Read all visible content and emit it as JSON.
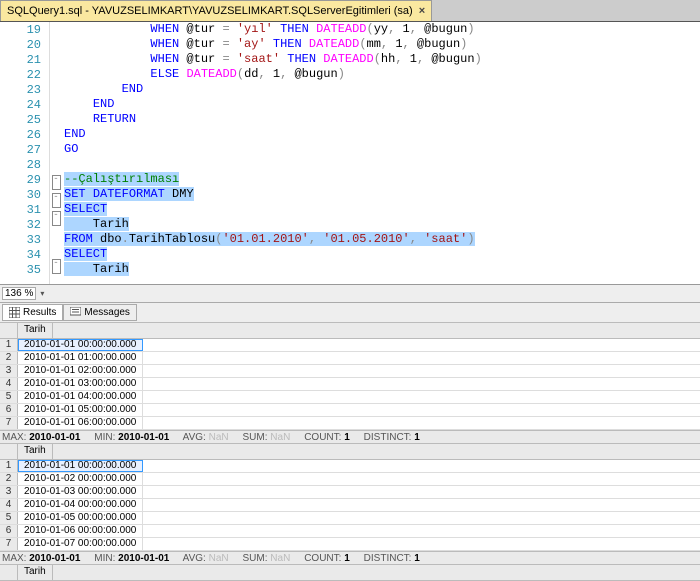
{
  "tab": {
    "title": "SQLQuery1.sql - YAVUZSELIMKART\\YAVUZSELIMKART.SQLServerEgitimleri (sa)",
    "close": "×"
  },
  "editor": {
    "lines": [
      {
        "n": 19,
        "html": "            <span class='kw'>WHEN</span> @tur <span class='op'>=</span> <span class='str'>'yıl'</span> <span class='kw'>THEN</span> <span class='fn'>DATEADD</span><span class='op'>(</span>yy<span class='op'>,</span> <span class='num'>1</span><span class='op'>,</span> @bugun<span class='op'>)</span>"
      },
      {
        "n": 20,
        "html": "            <span class='kw'>WHEN</span> @tur <span class='op'>=</span> <span class='str'>'ay'</span> <span class='kw'>THEN</span> <span class='fn'>DATEADD</span><span class='op'>(</span>mm<span class='op'>,</span> <span class='num'>1</span><span class='op'>,</span> @bugun<span class='op'>)</span>"
      },
      {
        "n": 21,
        "html": "            <span class='kw'>WHEN</span> @tur <span class='op'>=</span> <span class='str'>'saat'</span> <span class='kw'>THEN</span> <span class='fn'>DATEADD</span><span class='op'>(</span>hh<span class='op'>,</span> <span class='num'>1</span><span class='op'>,</span> @bugun<span class='op'>)</span>"
      },
      {
        "n": 22,
        "html": "            <span class='kw'>ELSE</span> <span class='fn'>DATEADD</span><span class='op'>(</span>dd<span class='op'>,</span> <span class='num'>1</span><span class='op'>,</span> @bugun<span class='op'>)</span>"
      },
      {
        "n": 23,
        "html": "        <span class='kw'>END</span>"
      },
      {
        "n": 24,
        "html": "    <span class='kw'>END</span>"
      },
      {
        "n": 25,
        "html": "    <span class='kw'>RETURN</span>"
      },
      {
        "n": 26,
        "html": "<span class='kw'>END</span>"
      },
      {
        "n": 27,
        "html": "<span class='kw'>GO</span>"
      },
      {
        "n": 28,
        "html": ""
      },
      {
        "n": 29,
        "html": "<span class='sel'><span class='cmt'>--Çalıştırılması</span></span>",
        "fold": "-"
      },
      {
        "n": 30,
        "html": "<span class='sel'><span class='kw'>SET</span> <span class='kw'>DATEFORMAT</span> DMY</span>",
        "fold": "-"
      },
      {
        "n": 31,
        "html": "<span class='sel'><span class='kw'>SELECT</span></span>",
        "fold": "-"
      },
      {
        "n": 32,
        "html": "<span class='sel'>    Tarih</span>"
      },
      {
        "n": 33,
        "html": "<span class='sel'><span class='kw'>FROM</span> dbo<span class='op'>.</span>TarihTablosu<span class='op'>(</span><span class='str'>'01.01.2010'</span><span class='op'>,</span> <span class='str'>'01.05.2010'</span><span class='op'>,</span> <span class='str'>'saat'</span><span class='op'>)</span></span>"
      },
      {
        "n": 34,
        "html": "<span class='sel'><span class='kw'>SELECT</span></span>",
        "fold": "-"
      },
      {
        "n": 35,
        "html": "<span class='sel'>    Tarih</span>"
      }
    ]
  },
  "zoom": {
    "value": "136 %"
  },
  "resultsTabs": {
    "results": "Results",
    "messages": "Messages"
  },
  "grid1": {
    "col": "Tarih",
    "rows": [
      "2010-01-01 00:00:00.000",
      "2010-01-01 01:00:00.000",
      "2010-01-01 02:00:00.000",
      "2010-01-01 03:00:00.000",
      "2010-01-01 04:00:00.000",
      "2010-01-01 05:00:00.000",
      "2010-01-01 06:00:00.000"
    ]
  },
  "stats1": {
    "max_lbl": "MAX: ",
    "max": "2010-01-01",
    "min_lbl": "     MIN: ",
    "min": "2010-01-01",
    "avg_lbl": "     AVG: ",
    "avg": "NaN",
    "sum_lbl": "     SUM: ",
    "sum": "NaN",
    "cnt_lbl": "     COUNT: ",
    "cnt": "1",
    "dst_lbl": "     DISTINCT: ",
    "dst": "1"
  },
  "grid2": {
    "col": "Tarih",
    "rows": [
      "2010-01-01 00:00:00.000",
      "2010-01-02 00:00:00.000",
      "2010-01-03 00:00:00.000",
      "2010-01-04 00:00:00.000",
      "2010-01-05 00:00:00.000",
      "2010-01-06 00:00:00.000",
      "2010-01-07 00:00:00.000"
    ]
  },
  "stats2": {
    "max_lbl": "MAX: ",
    "max": "2010-01-01",
    "min_lbl": "     MIN: ",
    "min": "2010-01-01",
    "avg_lbl": "     AVG: ",
    "avg": "NaN",
    "sum_lbl": "     SUM: ",
    "sum": "NaN",
    "cnt_lbl": "     COUNT: ",
    "cnt": "1",
    "dst_lbl": "     DISTINCT: ",
    "dst": "1"
  },
  "grid3": {
    "col": "Tarih"
  }
}
